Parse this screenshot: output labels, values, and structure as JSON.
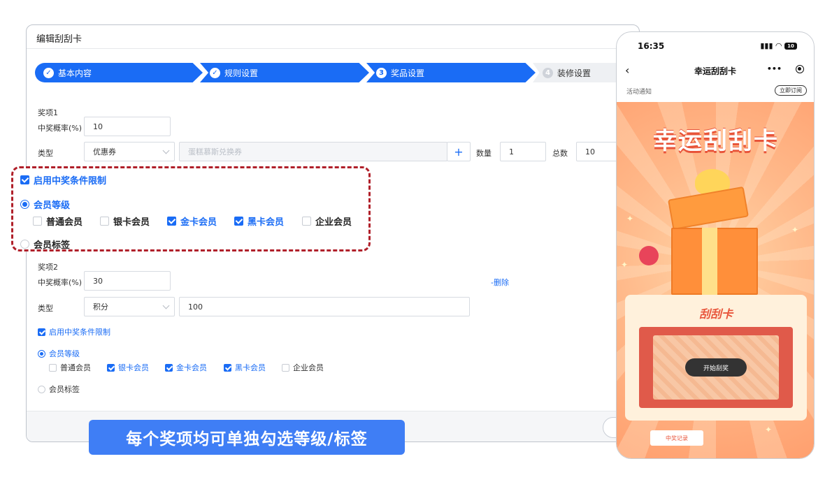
{
  "editor": {
    "title": "编辑刮刮卡",
    "steps": [
      {
        "label": "基本内容",
        "state": "done"
      },
      {
        "label": "规则设置",
        "state": "done"
      },
      {
        "label": "奖品设置",
        "state": "active",
        "number": "3"
      },
      {
        "label": "装修设置",
        "state": "pending",
        "number": "4"
      }
    ],
    "prize1": {
      "name": "奖项1",
      "rate_label": "中奖概率(%)",
      "rate_value": "10",
      "type_label": "类型",
      "type_value": "优惠券",
      "coupon_placeholder": "蛋糕慕斯兑换券",
      "add_icon": "plus-icon",
      "qty_label": "数量",
      "qty_value": "1",
      "total_label": "总数",
      "total_value": "10",
      "condition_label": "启用中奖条件限制",
      "condition_checked": true,
      "level_label": "会员等级",
      "levels": [
        {
          "label": "普通会员",
          "checked": false
        },
        {
          "label": "银卡会员",
          "checked": false
        },
        {
          "label": "金卡会员",
          "checked": true
        },
        {
          "label": "黑卡会员",
          "checked": true
        },
        {
          "label": "企业会员",
          "checked": false
        }
      ],
      "tag_label": "会员标签"
    },
    "prize2": {
      "name": "奖项2",
      "rate_label": "中奖概率(%)",
      "rate_value": "30",
      "delete_label": "-删除",
      "type_label": "类型",
      "type_value": "积分",
      "points_value": "100",
      "condition_label": "启用中奖条件限制",
      "condition_checked": true,
      "level_label": "会员等级",
      "levels": [
        {
          "label": "普通会员",
          "checked": false
        },
        {
          "label": "银卡会员",
          "checked": true
        },
        {
          "label": "金卡会员",
          "checked": true
        },
        {
          "label": "黑卡会员",
          "checked": true
        },
        {
          "label": "企业会员",
          "checked": false
        }
      ],
      "tag_label": "会员标签"
    }
  },
  "caption": "每个奖项均可单独勾选等级/标签",
  "phone": {
    "time": "16:35",
    "battery": "10",
    "title": "幸运刮刮卡",
    "more": "•••",
    "notice": "活动通知",
    "subscribe": "立即订阅",
    "banner": "幸运刮刮卡",
    "card_title": "刮刮卡",
    "scratch_button": "开始刮奖",
    "record_button": "中奖记录"
  },
  "colors": {
    "primary": "#1a6cf5",
    "highlight_border": "#b0202a",
    "caption_bg": "#3f7ef5",
    "accent_orange": "#e8543a"
  }
}
